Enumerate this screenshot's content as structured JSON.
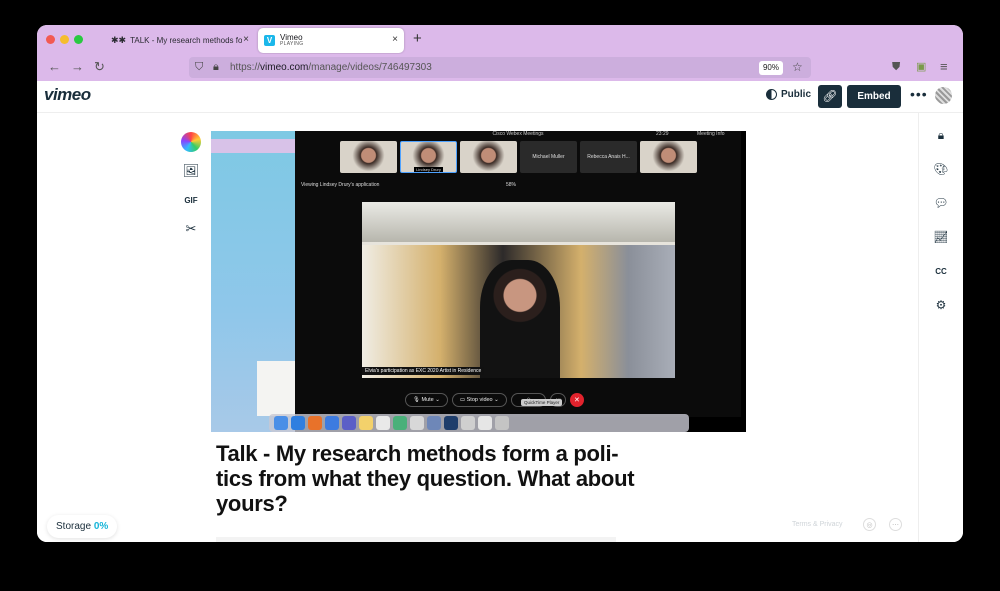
{
  "browser": {
    "tabs": [
      {
        "icon": "✱✱",
        "title": "TALK - My research methods fo",
        "close": "×"
      },
      {
        "title": "Vimeo",
        "subtitle": "PLAYING",
        "close": "×"
      }
    ],
    "new_tab": "+",
    "url_scheme": "https://",
    "url_host": "vimeo.com",
    "url_path": "/manage/videos/746497303",
    "zoom": "90%"
  },
  "header": {
    "logo": "vimeo",
    "public_label": "Public",
    "embed_label": "Embed",
    "more": "•••"
  },
  "left_tools": {
    "gif_label": "GIF"
  },
  "video": {
    "app_title": "Cisco Webex Meetings",
    "time": "23:29",
    "meeting_info": "Meeting Info",
    "participants": [
      "",
      "Lindsey Drury",
      "",
      "Michael Muller",
      "Rebecca Anais H...",
      ""
    ],
    "viewing_label": "Viewing Lindsey Drury's application",
    "zoom_level": "58%",
    "caption": "Elvia's participation as EXC 2020 Artist in Residence",
    "mute_label": "Mute",
    "stop_video_label": "Stop video",
    "tooltip": "QuickTime Player"
  },
  "title": "Talk - My research methods form a poli-tics from what they question. What about yours?",
  "storage": {
    "label": "Storage",
    "percent": "0%"
  },
  "footer": {
    "terms": "Terms & Privacy"
  },
  "colors": {
    "browser_chrome": "#dcb9ea",
    "vimeo_navy": "#1a2e3b",
    "storage_accent": "#17b5d9",
    "end_call_red": "#e2232d"
  }
}
